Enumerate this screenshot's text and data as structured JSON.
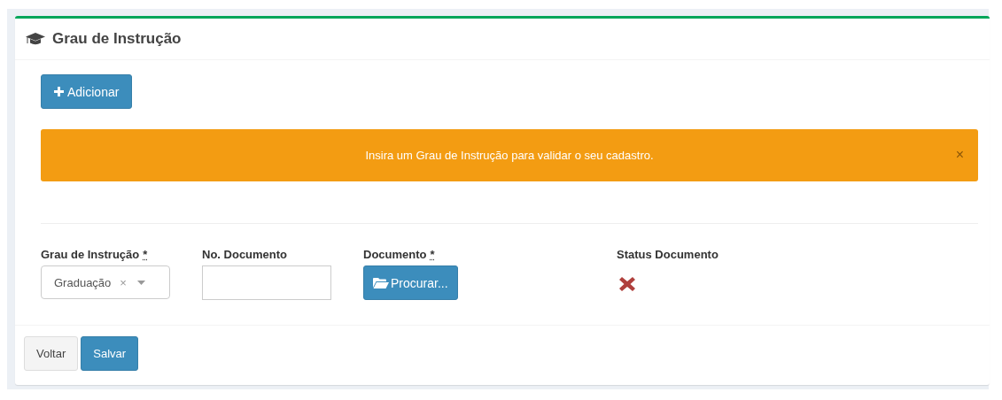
{
  "panel": {
    "title": "Grau de Instrução"
  },
  "add_button": {
    "label": "Adicionar"
  },
  "alert": {
    "kind": "warning",
    "message": "Insira um Grau de Instrução para validar o seu cadastro.",
    "close": "×"
  },
  "fields": [
    {
      "kind": "select",
      "label": "Grau de Instrução",
      "required_mark": "*",
      "value": "Graduação",
      "clear": "×"
    },
    {
      "kind": "input",
      "label": "No. Documento"
    },
    {
      "kind": "file",
      "label": "Documento",
      "required_mark": "*",
      "button": "Procurar..."
    },
    {
      "kind": "status",
      "label": "Status Documento",
      "valid": false
    }
  ],
  "footer_buttons": [
    {
      "label": "Voltar",
      "kind": "default"
    },
    {
      "label": "Salvar",
      "kind": "primary"
    }
  ]
}
